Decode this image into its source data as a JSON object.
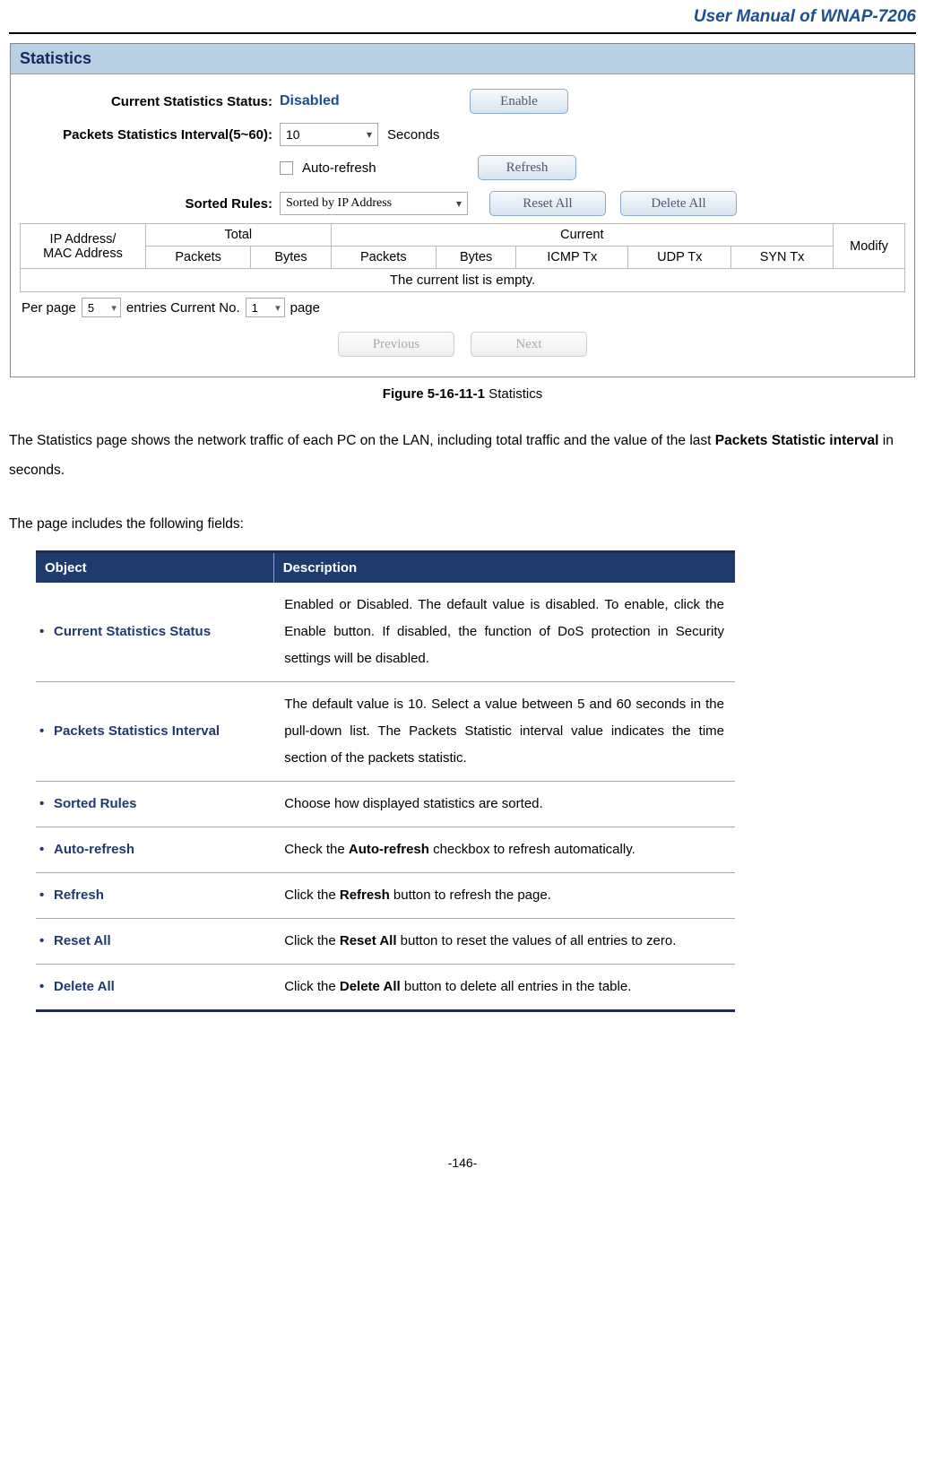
{
  "header": {
    "manual_title": "User Manual of WNAP-7206"
  },
  "screenshot": {
    "panel_title": "Statistics",
    "rows": {
      "status_label": "Current Statistics Status:",
      "status_value": "Disabled",
      "enable_btn": "Enable",
      "interval_label": "Packets Statistics Interval(5~60):",
      "interval_value": "10",
      "interval_unit": "Seconds",
      "auto_refresh_label": "Auto-refresh",
      "refresh_btn": "Refresh",
      "sorted_label": "Sorted Rules:",
      "sorted_value": "Sorted by IP Address",
      "reset_all_btn": "Reset All",
      "delete_all_btn": "Delete All"
    },
    "table": {
      "blank_hdr": "",
      "total_hdr": "Total",
      "current_hdr": "Current",
      "modify_hdr": "Modify",
      "ipmac_hdr": "IP Address/\nMAC Address",
      "packets_hdr": "Packets",
      "bytes_hdr": "Bytes",
      "icmp_hdr": "ICMP Tx",
      "udp_hdr": "UDP Tx",
      "syn_hdr": "SYN Tx",
      "empty_msg": "The current list is empty."
    },
    "pager": {
      "per_page_pre": "Per page",
      "per_page_val": "5",
      "per_page_post": "entries  Current No.",
      "page_val": "1",
      "page_post": "page",
      "prev": "Previous",
      "next": "Next"
    }
  },
  "caption": {
    "fig_num": "Figure 5-16-11-1",
    "fig_title": " Statistics"
  },
  "paragraphs": {
    "p1_pre": "The Statistics page shows the network traffic of each PC on the LAN, including total traffic and the value of the last ",
    "p1_bold": "Packets Statistic interval",
    "p1_post": " in seconds.",
    "p2": "The page includes the following fields:"
  },
  "desc_table": {
    "hdr_obj": "Object",
    "hdr_desc": "Description",
    "rows": [
      {
        "obj": "Current Statistics Status",
        "desc": "Enabled or Disabled. The default value is disabled. To enable, click the Enable button. If disabled, the function of DoS protection in Security settings will be disabled."
      },
      {
        "obj": "Packets Statistics Interval",
        "desc": "The default value is 10. Select a value between 5 and 60 seconds in the pull-down list. The Packets Statistic interval value indicates the time section of the packets statistic."
      },
      {
        "obj": "Sorted Rules",
        "desc": "Choose how displayed statistics are sorted."
      },
      {
        "obj": "Auto-refresh",
        "desc_pre": "Check the ",
        "desc_bold": "Auto-refresh",
        "desc_post": " checkbox to refresh automatically."
      },
      {
        "obj": "Refresh",
        "desc_pre": "Click the ",
        "desc_bold": "Refresh",
        "desc_post": " button to refresh the page."
      },
      {
        "obj": "Reset All",
        "desc_pre": "Click the ",
        "desc_bold": "Reset All",
        "desc_post": " button to reset the values of all entries to zero."
      },
      {
        "obj": "Delete All",
        "desc_pre": "Click the ",
        "desc_bold": "Delete All",
        "desc_post": " button to delete all entries in the table."
      }
    ]
  },
  "footer": {
    "page_num": "-146-"
  }
}
